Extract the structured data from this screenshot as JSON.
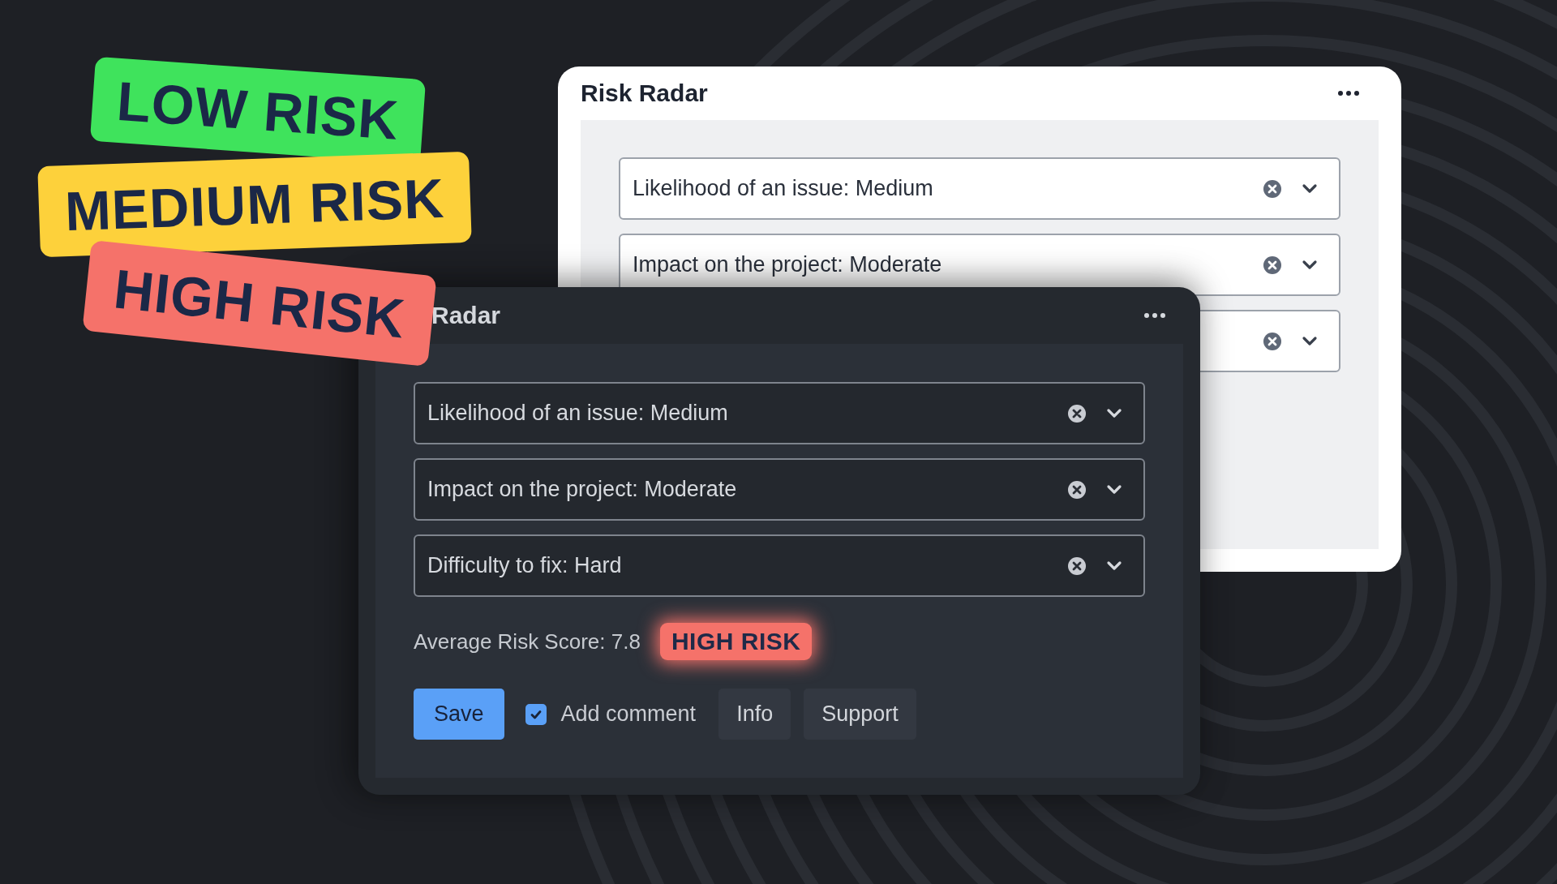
{
  "stickers": [
    {
      "label": "LOW RISK",
      "kind": "low",
      "color": "#3fe35c"
    },
    {
      "label": "MEDIUM RISK",
      "kind": "medium",
      "color": "#fdd13b"
    },
    {
      "label": "HIGH RISK",
      "kind": "high",
      "color": "#f5726a"
    }
  ],
  "light_window": {
    "title": "Risk Radar",
    "fields": [
      {
        "value": "Likelihood of an issue: Medium",
        "clearable": true
      },
      {
        "value": "Impact on the project: Moderate",
        "clearable": true
      },
      {
        "clearable": true
      }
    ]
  },
  "dark_window": {
    "title": "Radar",
    "fields": [
      {
        "value": "Likelihood of an issue: Medium",
        "clearable": true
      },
      {
        "value": "Impact on the project: Moderate",
        "clearable": true
      },
      {
        "value": "Difficulty to fix: Hard",
        "clearable": true
      }
    ],
    "score_label": "Average Risk Score: 7.8",
    "risk_badge": {
      "label": "HIGH RISK",
      "color": "#f5726a"
    },
    "controls": [
      {
        "kind": "primary",
        "label": "Save"
      },
      {
        "kind": "checkbox",
        "label": "Add comment",
        "checked": true
      },
      {
        "kind": "secondary",
        "label": "Info"
      },
      {
        "kind": "secondary",
        "label": "Support"
      }
    ]
  }
}
